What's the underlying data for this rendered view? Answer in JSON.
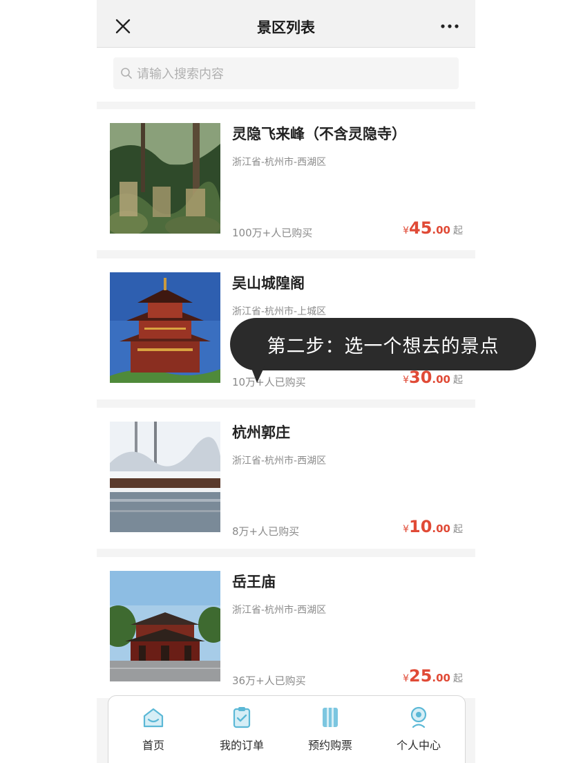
{
  "nav": {
    "title": "景区列表"
  },
  "search": {
    "placeholder": "请输入搜索内容"
  },
  "scenics": [
    {
      "name": "灵隐飞来峰（不含灵隐寺）",
      "location": "浙江省-杭州市-西湖区",
      "sold": "100万+人已购买",
      "currency": "¥",
      "price_int": "45",
      "price_dec": ".00",
      "suffix": "起"
    },
    {
      "name": "吴山城隍阁",
      "location": "浙江省-杭州市-上城区",
      "sold": "10万+人已购买",
      "currency": "¥",
      "price_int": "30",
      "price_dec": ".00",
      "suffix": "起"
    },
    {
      "name": "杭州郭庄",
      "location": "浙江省-杭州市-西湖区",
      "sold": "8万+人已购买",
      "currency": "¥",
      "price_int": "10",
      "price_dec": ".00",
      "suffix": "起"
    },
    {
      "name": "岳王庙",
      "location": "浙江省-杭州市-西湖区",
      "sold": "36万+人已购买",
      "currency": "¥",
      "price_int": "25",
      "price_dec": ".00",
      "suffix": "起"
    }
  ],
  "tabbar": {
    "items": [
      {
        "label": "首页",
        "icon": "home-icon"
      },
      {
        "label": "我的订单",
        "icon": "orders-icon"
      },
      {
        "label": "预约购票",
        "icon": "ticket-icon"
      },
      {
        "label": "个人中心",
        "icon": "profile-icon"
      }
    ]
  },
  "tooltip": {
    "text": "第二步：选一个想去的景点"
  },
  "colors": {
    "price": "#e04a36",
    "tab_icon": "#5bb8d6",
    "bubble": "#2b2b2b"
  }
}
